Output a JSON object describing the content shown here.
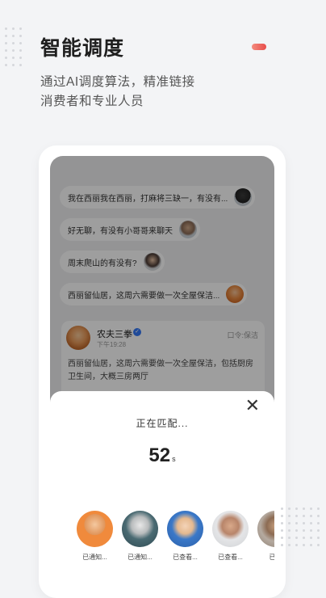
{
  "header": {
    "title": "智能调度",
    "subtitle_line1": "通过AI调度算法，精准链接",
    "subtitle_line2": "消费者和专业人员"
  },
  "messages": [
    {
      "text": "我在西丽我在西丽，打麻将三缺一，有没有...",
      "avatar": "woman-avatar"
    },
    {
      "text": "好无聊，有没有小哥哥来聊天",
      "avatar": "man-avatar"
    },
    {
      "text": "周末爬山的有没有?",
      "avatar": "woman-avatar"
    },
    {
      "text": "西丽留仙居，这周六需要做一次全屋保洁...",
      "avatar": "man-avatar"
    }
  ],
  "card": {
    "name": "农夫三拳",
    "time": "下午19:28",
    "tag": "口令:保洁",
    "body": "西丽留仙居，这周六需要做一次全屋保洁，包括厨房卫生间，大概三房两厅"
  },
  "sheet": {
    "status": "正在匹配...",
    "count": "52",
    "unit": "s"
  },
  "people": [
    {
      "label": "已通知...",
      "color": "#f08a3c"
    },
    {
      "label": "已通知...",
      "color": "#4a6a72"
    },
    {
      "label": "已查看...",
      "color": "#3a78c8"
    },
    {
      "label": "已查看...",
      "color": "#d0d2d5"
    },
    {
      "label": "已通",
      "color": "#8c7e70"
    }
  ]
}
